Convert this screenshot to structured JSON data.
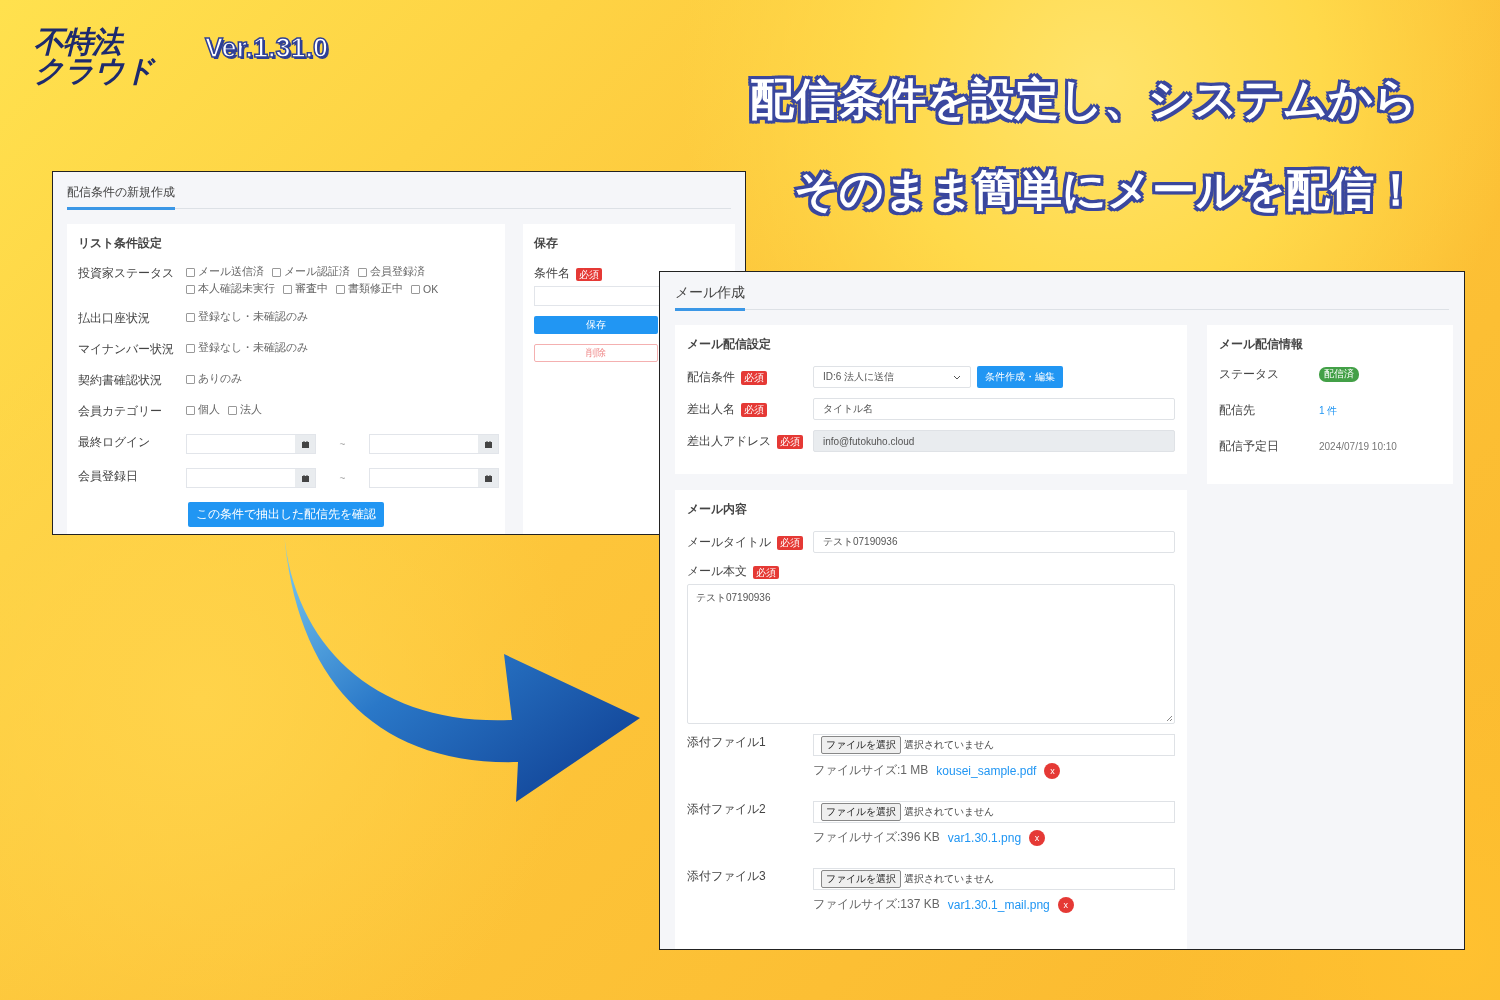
{
  "logo": {
    "line_1": "不特法",
    "line_2": "クラウド"
  },
  "version": "Ver.1.31.0",
  "headline": [
    "配信条件を設定し、システムから",
    "そのまま簡単にメールを配信！"
  ],
  "condition_window": {
    "title": "配信条件の新規作成",
    "list_panel": {
      "title": "リスト条件設定",
      "rows": [
        {
          "kind": "checkboxes",
          "label": "投資家ステータス",
          "options": [
            {
              "label": "メール送信済",
              "checked": false
            },
            {
              "label": "メール認証済",
              "checked": false
            },
            {
              "label": "会員登録済",
              "checked": false
            },
            {
              "label": "本人確認未実行",
              "checked": false
            },
            {
              "label": "審査中",
              "checked": false
            },
            {
              "label": "書類修正中",
              "checked": false
            },
            {
              "label": "OK",
              "checked": false
            }
          ]
        },
        {
          "kind": "checkboxes",
          "label": "払出口座状況",
          "options": [
            {
              "label": "登録なし・未確認のみ",
              "checked": false
            }
          ]
        },
        {
          "kind": "checkboxes",
          "label": "マイナンバー状況",
          "options": [
            {
              "label": "登録なし・未確認のみ",
              "checked": false
            }
          ]
        },
        {
          "kind": "checkboxes",
          "label": "契約書確認状況",
          "options": [
            {
              "label": "ありのみ",
              "checked": false
            }
          ]
        },
        {
          "kind": "checkboxes",
          "label": "会員カテゴリー",
          "options": [
            {
              "label": "個人",
              "checked": false
            },
            {
              "label": "法人",
              "checked": false
            }
          ]
        },
        {
          "kind": "date_range",
          "label": "最終ログイン",
          "separator": "~"
        },
        {
          "kind": "date_range",
          "label": "会員登録日",
          "separator": "~"
        }
      ],
      "button": "この条件で抽出した配信先を確認"
    },
    "save_panel": {
      "title": "保存",
      "field_label": "条件名",
      "required_badge": "必須",
      "save_button": "保存",
      "delete_button": "削除"
    }
  },
  "mail_window": {
    "title": "メール作成",
    "settings_panel": {
      "title": "メール配信設定",
      "rows": [
        {
          "kind": "select",
          "label": "配信条件",
          "required_badge": "必須",
          "value": "ID:6 法人に送信",
          "button": "条件作成・編集"
        },
        {
          "kind": "text",
          "label": "差出人名",
          "required_badge": "必須",
          "value": "タイトル名"
        },
        {
          "kind": "readonly",
          "label": "差出人アドレス",
          "required_badge": "必須",
          "value": "info@futokuho.cloud"
        }
      ]
    },
    "info_panel": {
      "title": "メール配信情報",
      "rows": [
        {
          "kind": "badge",
          "label": "ステータス",
          "value": "配信済"
        },
        {
          "kind": "link",
          "label": "配信先",
          "value": "1 件"
        },
        {
          "kind": "text",
          "label": "配信予定日",
          "value": "2024/07/19 10:10"
        }
      ]
    },
    "content_panel": {
      "title": "メール内容",
      "subject": {
        "label": "メールタイトル",
        "required_badge": "必須",
        "value": "テスト07190936"
      },
      "body": {
        "label": "メール本文",
        "required_badge": "必須",
        "value": "テスト07190936"
      },
      "attachments": [
        {
          "label": "添付ファイル1",
          "choose_button": "ファイルを選択",
          "status": "選択されていません",
          "size": "ファイルサイズ:1 MB",
          "file": "kousei_sample.pdf",
          "remove": "x"
        },
        {
          "label": "添付ファイル2",
          "choose_button": "ファイルを選択",
          "status": "選択されていません",
          "size": "ファイルサイズ:396 KB",
          "file": "var1.30.1.png",
          "remove": "x"
        },
        {
          "label": "添付ファイル3",
          "choose_button": "ファイルを選択",
          "status": "選択されていません",
          "size": "ファイルサイズ:137 KB",
          "file": "var1.30.1_mail.png",
          "remove": "x"
        }
      ]
    }
  }
}
